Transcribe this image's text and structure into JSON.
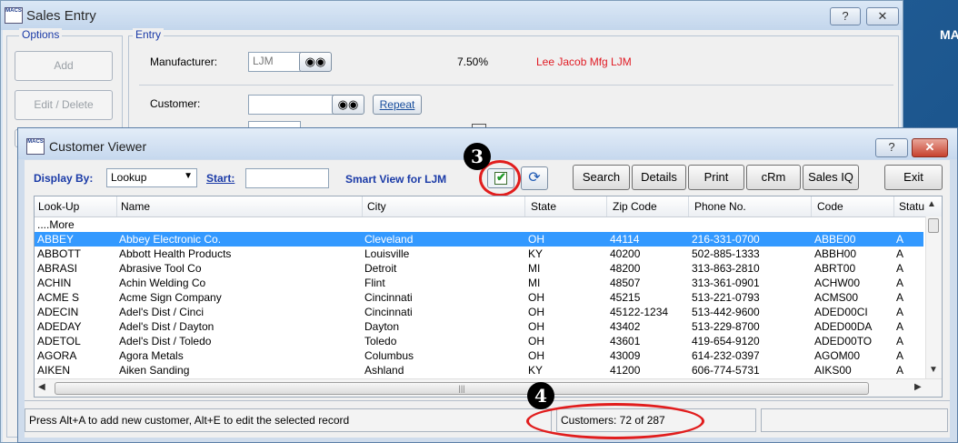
{
  "desktop": {
    "text": "MA"
  },
  "sales_window": {
    "title": "Sales Entry",
    "help_label": "?",
    "close_label": "✕",
    "options": {
      "legend": "Options",
      "add_label": "Add",
      "edit_delete_label": "Edit / Delete"
    },
    "entry": {
      "legend": "Entry",
      "manufacturer_label": "Manufacturer:",
      "manufacturer_value": "LJM",
      "percent": "7.50%",
      "manufacturer_name": "Lee Jacob Mfg  LJM",
      "customer_label": "Customer:",
      "repeat_label": "Repeat"
    }
  },
  "customer_viewer": {
    "title": "Customer Viewer",
    "help_label": "?",
    "close_label": "✕",
    "display_by_label": "Display By:",
    "display_by_value": "Lookup",
    "start_label": "Start:",
    "smart_view_label": "Smart View for LJM",
    "buttons": {
      "search": "Search",
      "details": "Details",
      "print": "Print",
      "crm": "cRm",
      "sales_iq": "Sales IQ",
      "exit": "Exit"
    },
    "columns": [
      "Look-Up",
      "Name",
      "City",
      "State",
      "Zip Code",
      "Phone No.",
      "Code",
      "Statu"
    ],
    "more_label": "....More",
    "rows": [
      [
        "ABBEY",
        "Abbey Electronic Co.",
        "Cleveland",
        "OH",
        "44114",
        "216-331-0700",
        "ABBE00",
        "A"
      ],
      [
        "ABBOTT",
        "Abbott Health Products",
        "Louisville",
        "KY",
        "40200",
        "502-885-1333",
        "ABBH00",
        "A"
      ],
      [
        "ABRASI",
        "Abrasive Tool Co",
        "Detroit",
        "MI",
        "48200",
        "313-863-2810",
        "ABRT00",
        "A"
      ],
      [
        "ACHIN",
        "Achin Welding Co",
        "Flint",
        "MI",
        "48507",
        "313-361-0901",
        "ACHW00",
        "A"
      ],
      [
        "ACME S",
        "Acme Sign Company",
        "Cincinnati",
        "OH",
        "45215",
        "513-221-0793",
        "ACMS00",
        "A"
      ],
      [
        "ADECIN",
        "Adel's Dist / Cinci",
        "Cincinnati",
        "OH",
        "45122-1234",
        "513-442-9600",
        "ADED00CI",
        "A"
      ],
      [
        "ADEDAY",
        "Adel's Dist / Dayton",
        "Dayton",
        "OH",
        "43402",
        "513-229-8700",
        "ADED00DA",
        "A"
      ],
      [
        "ADETOL",
        "Adel's Dist / Toledo",
        "Toledo",
        "OH",
        "43601",
        "419-654-9120",
        "ADED00TO",
        "A"
      ],
      [
        "AGORA",
        "Agora Metals",
        "Columbus",
        "OH",
        "43009",
        "614-232-0397",
        "AGOM00",
        "A"
      ],
      [
        "AIKEN",
        "Aiken Sanding",
        "Ashland",
        "KY",
        "41200",
        "606-774-5731",
        "AIKS00",
        "A"
      ]
    ],
    "status_hint": "Press Alt+A to add new customer,   Alt+E to edit the selected record",
    "customers_count": "Customers: 72 of 287"
  },
  "callouts": {
    "three": "3",
    "four": "4"
  },
  "colors": {
    "selection": "#3399ff",
    "manufacturer_name": "#e01b24",
    "label_blue": "#1a3aa7",
    "callout_ring": "#e11d1d"
  }
}
